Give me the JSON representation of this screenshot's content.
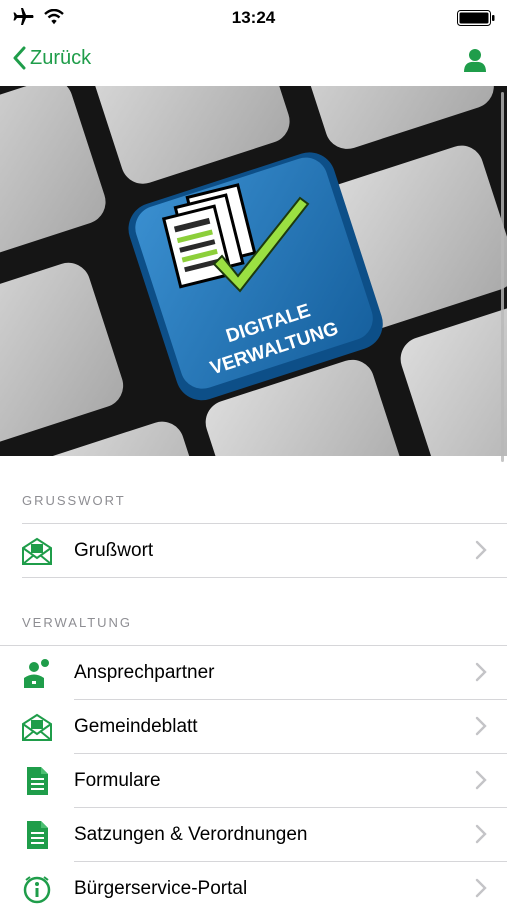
{
  "status": {
    "time": "13:24",
    "icons": [
      "airplane-icon",
      "wifi-icon",
      "battery-icon"
    ]
  },
  "nav": {
    "back_label": "Zurück",
    "accent_color": "#1f9d4a"
  },
  "hero": {
    "key_line1": "DIGITALE",
    "key_line2": "VERWALTUNG"
  },
  "sections": [
    {
      "header": "GRUSSWORT",
      "items": [
        {
          "label": "Grußwort",
          "icon": "envelope-icon"
        }
      ]
    },
    {
      "header": "VERWALTUNG",
      "items": [
        {
          "label": "Ansprechpartner",
          "icon": "contact-person-icon"
        },
        {
          "label": "Gemeindeblatt",
          "icon": "envelope-icon"
        },
        {
          "label": "Formulare",
          "icon": "document-icon"
        },
        {
          "label": "Satzungen & Verordnungen",
          "icon": "document-icon"
        },
        {
          "label": "Bürgerservice-Portal",
          "icon": "info-icon"
        }
      ]
    }
  ]
}
